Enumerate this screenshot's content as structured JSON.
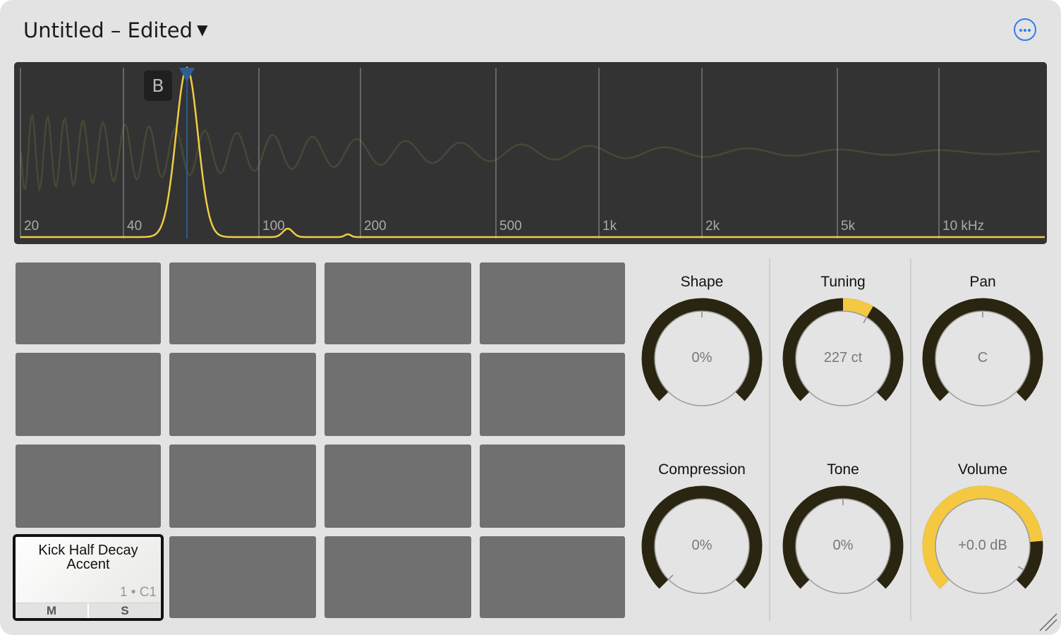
{
  "header": {
    "title": "Untitled – Edited",
    "caret": "▼",
    "more_icon": "ellipsis-circle-icon"
  },
  "spectrum": {
    "freq_labels": [
      "20",
      "40",
      "100",
      "200",
      "500",
      "1k",
      "2k",
      "5k",
      "10 kHz"
    ],
    "band_marker": "B",
    "curve_color": "#f2cc44",
    "marker_color": "#2a5a8a"
  },
  "pads": {
    "selected": {
      "name_line1": "Kick Half Decay",
      "name_line2": "Accent",
      "note": "1 • C1",
      "mute": "M",
      "solo": "S"
    }
  },
  "knobs": [
    {
      "label": "Shape",
      "value": "0%",
      "fraction": 0.0
    },
    {
      "label": "Tuning",
      "value": "227 ct",
      "fraction": 0.1
    },
    {
      "label": "Pan",
      "value": "C",
      "fraction": 0.5
    },
    {
      "label": "Compression",
      "value": "0%",
      "fraction": 0.0
    },
    {
      "label": "Tone",
      "value": "0%",
      "fraction": 0.5
    },
    {
      "label": "Volume",
      "value": "+0.0 dB",
      "fraction": 0.8
    }
  ],
  "colors": {
    "knob_track": "#2a2510",
    "knob_fill": "#f5c842",
    "accent": "#2f7df0"
  }
}
